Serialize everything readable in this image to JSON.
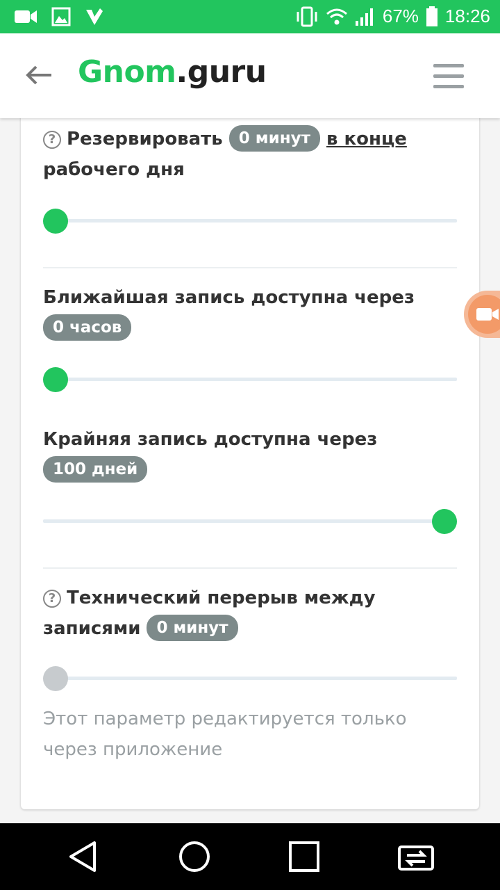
{
  "status_bar": {
    "battery_percent": "67%",
    "time": "18:26",
    "icons": [
      "video-camera-icon",
      "image-icon",
      "checkmark-app-icon",
      "vibrate-icon",
      "wifi-icon",
      "signal-icon",
      "battery-icon"
    ]
  },
  "header": {
    "logo_part1": "Gnom",
    "logo_part2": ".guru",
    "back_icon": "arrow-left-icon",
    "menu_icon": "hamburger-menu-icon"
  },
  "settings": {
    "reserve": {
      "label": "Резервировать",
      "badge": "0 минут",
      "link": "в конце",
      "label_suffix": "рабочего дня",
      "slider_fraction": 0.0
    },
    "nearest": {
      "label": "Ближайшая запись доступна через",
      "badge": "0 часов",
      "slider_fraction": 0.0
    },
    "furthest": {
      "label": "Крайняя запись доступна через",
      "badge": "100 дней",
      "slider_fraction": 1.0
    },
    "break": {
      "label": "Технический перерыв между",
      "label_suffix": "записями",
      "badge": "0 минут",
      "slider_fraction": 0.0,
      "note": "Этот параметр редактируется только через приложение"
    }
  },
  "navbar": {
    "buttons": [
      "back-triangle-icon",
      "home-circle-icon",
      "recents-square-icon",
      "switch-app-icon"
    ]
  },
  "colors": {
    "accent": "#22c55e",
    "badge": "#7d8a8a",
    "disabled_thumb": "#c7cbce"
  }
}
